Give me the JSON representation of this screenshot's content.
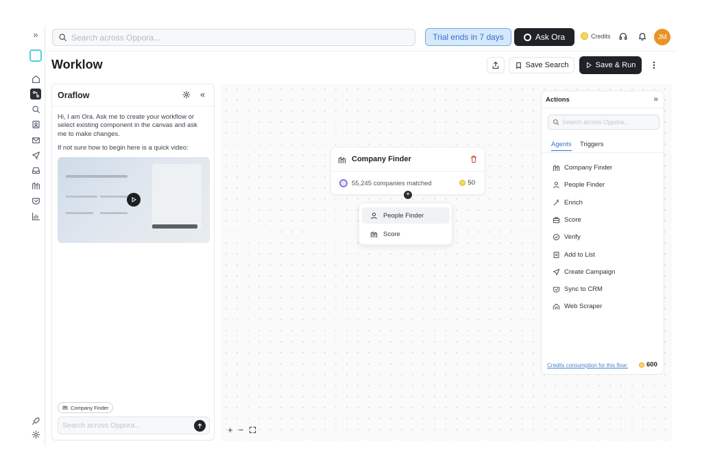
{
  "rail": {
    "collapse_glyph": "»",
    "items": [
      "home-icon",
      "workflow-icon",
      "search-icon",
      "contacts-icon",
      "mail-icon",
      "send-icon",
      "inbox-icon",
      "companies-icon",
      "crm-icon",
      "analytics-icon"
    ],
    "bottom": [
      "rocket-icon",
      "gear-icon"
    ]
  },
  "topbar": {
    "search_placeholder": "Search across Oppora...",
    "trial_label": "Trial ends in 7 days",
    "ask_label": "Ask Ora",
    "credits_label": "Credits",
    "avatar_initials": "JM",
    "colors": {
      "trial_bg": "#d7e8fb",
      "trial_text": "#2f6fd1",
      "avatar": "#e89423"
    }
  },
  "page": {
    "title": "Worklow",
    "save_search_label": "Save Search",
    "save_run_label": "Save & Run"
  },
  "oraflow": {
    "title": "Oraflow",
    "collapse_glyph": "«",
    "intro": "Hi, I am Ora. Ask me to create your workflow or select existing component in the canvas and ask me to make changes.",
    "hint": "If not sure how to begin here is a quick video:",
    "context_chip": "Company Finder",
    "input_placeholder": "Search across Oppora..."
  },
  "canvas": {
    "node": {
      "title": "Company Finder",
      "matched": "55,245 companies matched",
      "cost": "50"
    },
    "add_glyph": "+",
    "popup": [
      "People Finder",
      "Score"
    ],
    "zoom": {
      "in": "+",
      "out": "−"
    }
  },
  "actions": {
    "title": "Actions",
    "collapse_glyph": "»",
    "search_placeholder": "Search across Oppora...",
    "tabs": [
      "Agents",
      "Triggers"
    ],
    "agents": [
      {
        "label": "Company Finder",
        "icon": "building-icon"
      },
      {
        "label": "People Finder",
        "icon": "person-icon"
      },
      {
        "label": "Enrich",
        "icon": "wand-icon"
      },
      {
        "label": "Score",
        "icon": "score-icon"
      },
      {
        "label": "Verify",
        "icon": "check-circle-icon"
      },
      {
        "label": "Add to List",
        "icon": "list-icon"
      },
      {
        "label": "Create Campaign",
        "icon": "send-icon"
      },
      {
        "label": "Sync to CRM",
        "icon": "crm-icon"
      },
      {
        "label": "Web Scraper",
        "icon": "scraper-icon"
      }
    ],
    "footer_label": "Credits consumption for this flow:",
    "footer_value": "600"
  }
}
